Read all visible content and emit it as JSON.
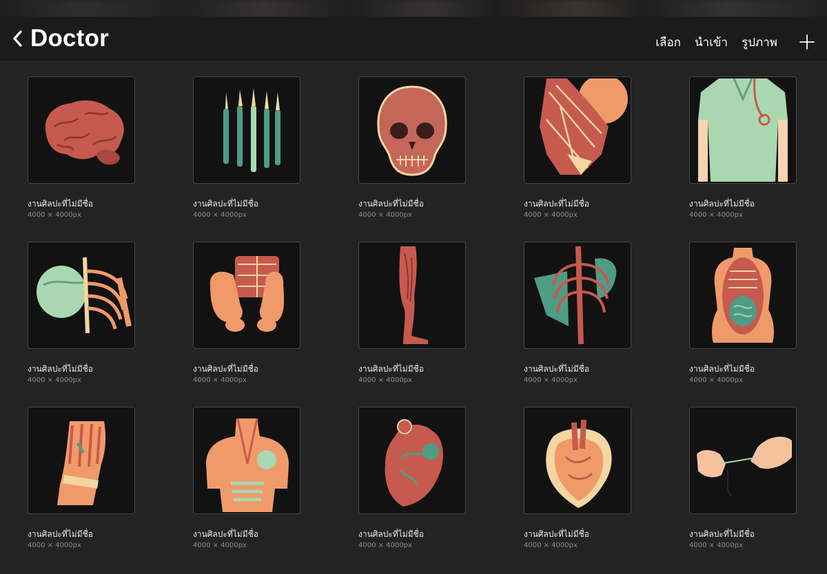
{
  "header": {
    "back_icon": "chevron-left-icon",
    "title": "Doctor",
    "actions": [
      "เลือก",
      "นำเข้า",
      "รูปภาพ"
    ],
    "add_icon": "plus-icon"
  },
  "colors": {
    "background": "#232323",
    "header": "#1b1b1b",
    "thumb_background": "#121212",
    "thumb_border": "#474747",
    "flesh_red": "#c65a4e",
    "bone_cream": "#f4d6a1",
    "orange": "#f09a6a",
    "teal": "#4f9c86",
    "mint": "#a9d8b0"
  },
  "artworks": [
    {
      "name": "งานศิลปะที่ไม่มีชื่อ",
      "size": "4000 × 4000px",
      "subject": "brain"
    },
    {
      "name": "งานศิลปะที่ไม่มีชื่อ",
      "size": "4000 × 4000px",
      "subject": "scalpels"
    },
    {
      "name": "งานศิลปะที่ไม่มีชื่อ",
      "size": "4000 × 4000px",
      "subject": "skull"
    },
    {
      "name": "งานศิลปะที่ไม่มีชื่อ",
      "size": "4000 × 4000px",
      "subject": "neck-muscles"
    },
    {
      "name": "งานศิลปะที่ไม่มีชื่อ",
      "size": "4000 × 4000px",
      "subject": "doctor-scrubs"
    },
    {
      "name": "งานศิลปะที่ไม่มีชื่อ",
      "size": "4000 × 4000px",
      "subject": "shoulder-ribcage"
    },
    {
      "name": "งานศิลปะที่ไม่มีชื่อ",
      "size": "4000 × 4000px",
      "subject": "pelvis"
    },
    {
      "name": "งานศิลปะที่ไม่มีชื่อ",
      "size": "4000 × 4000px",
      "subject": "leg-muscles"
    },
    {
      "name": "งานศิลปะที่ไม่มีชื่อ",
      "size": "4000 × 4000px",
      "subject": "spine-back"
    },
    {
      "name": "งานศิลปะที่ไม่มีชื่อ",
      "size": "4000 × 4000px",
      "subject": "torso-organs"
    },
    {
      "name": "งานศิลปะที่ไม่มีชื่อ",
      "size": "4000 × 4000px",
      "subject": "hand-anatomy"
    },
    {
      "name": "งานศิลปะที่ไม่มีชื่อ",
      "size": "4000 × 4000px",
      "subject": "back-muscles"
    },
    {
      "name": "งานศิลปะที่ไม่มีชื่อ",
      "size": "4000 × 4000px",
      "subject": "heart"
    },
    {
      "name": "งานศิลปะที่ไม่มีชื่อ",
      "size": "4000 × 4000px",
      "subject": "heart-cross-section"
    },
    {
      "name": "งานศิลปะที่ไม่มีชื่อ",
      "size": "4000 × 4000px",
      "subject": "hands-suturing"
    }
  ]
}
